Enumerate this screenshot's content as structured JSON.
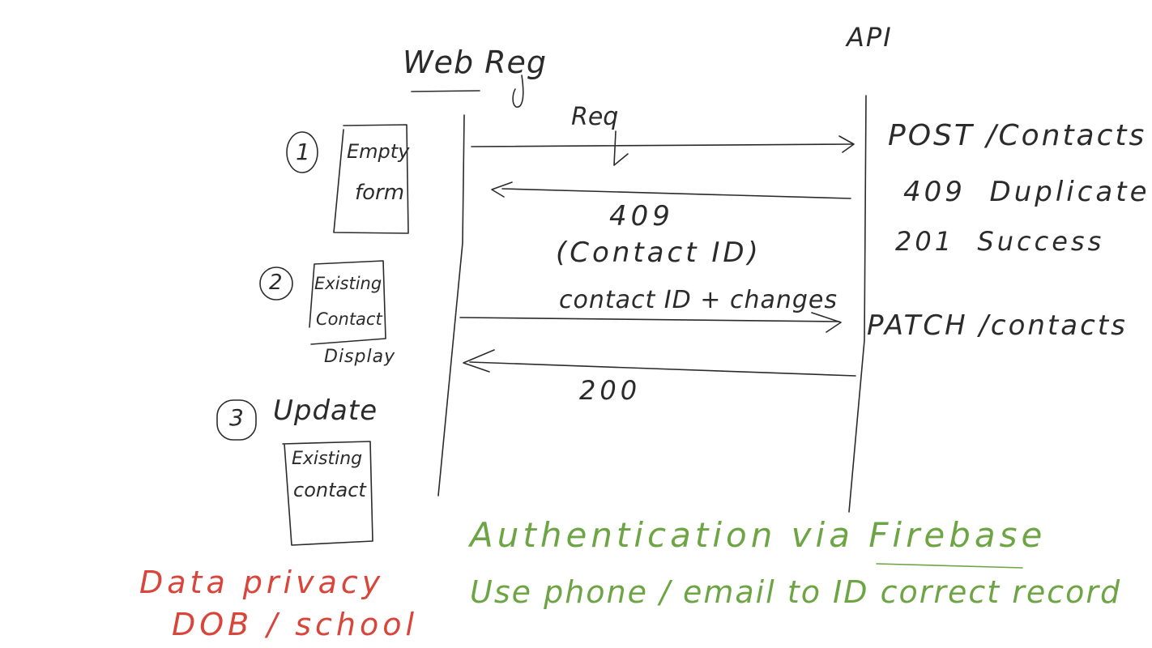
{
  "diagram": {
    "type": "sequence-diagram-sketch",
    "colors": {
      "ink": "#2b2b2b",
      "note_green": "#6ea544",
      "note_red": "#d9453a",
      "background": "#ffffff"
    },
    "participants": [
      {
        "id": "web",
        "label": "Web Reg"
      },
      {
        "id": "api",
        "label": "API"
      }
    ],
    "messages": [
      {
        "from": "web",
        "to": "api",
        "label": "Req"
      },
      {
        "from": "api",
        "to": "web",
        "label": "409",
        "sublabel": "(Contact ID)"
      },
      {
        "from": "web",
        "to": "api",
        "label": "contact ID + changes"
      },
      {
        "from": "api",
        "to": "web",
        "label": "200"
      }
    ],
    "api_notes": {
      "post": "POST /Contacts",
      "code_409": "409  Duplicate",
      "code_201": "201  Success",
      "patch": "PATCH /contacts"
    },
    "steps": [
      {
        "number": "1",
        "box_line1": "Empty",
        "box_line2": "form"
      },
      {
        "number": "2",
        "box_line1": "Existing",
        "box_line2": "Contact",
        "caption": "Display"
      },
      {
        "number": "3",
        "title": "Update",
        "box_line1": "Existing",
        "box_line2": "contact"
      }
    ],
    "notes": {
      "auth": "Authentication via Firebase",
      "identify": "Use phone / email to ID correct record",
      "privacy_line1": "Data privacy",
      "privacy_line2": "DOB / school"
    }
  }
}
